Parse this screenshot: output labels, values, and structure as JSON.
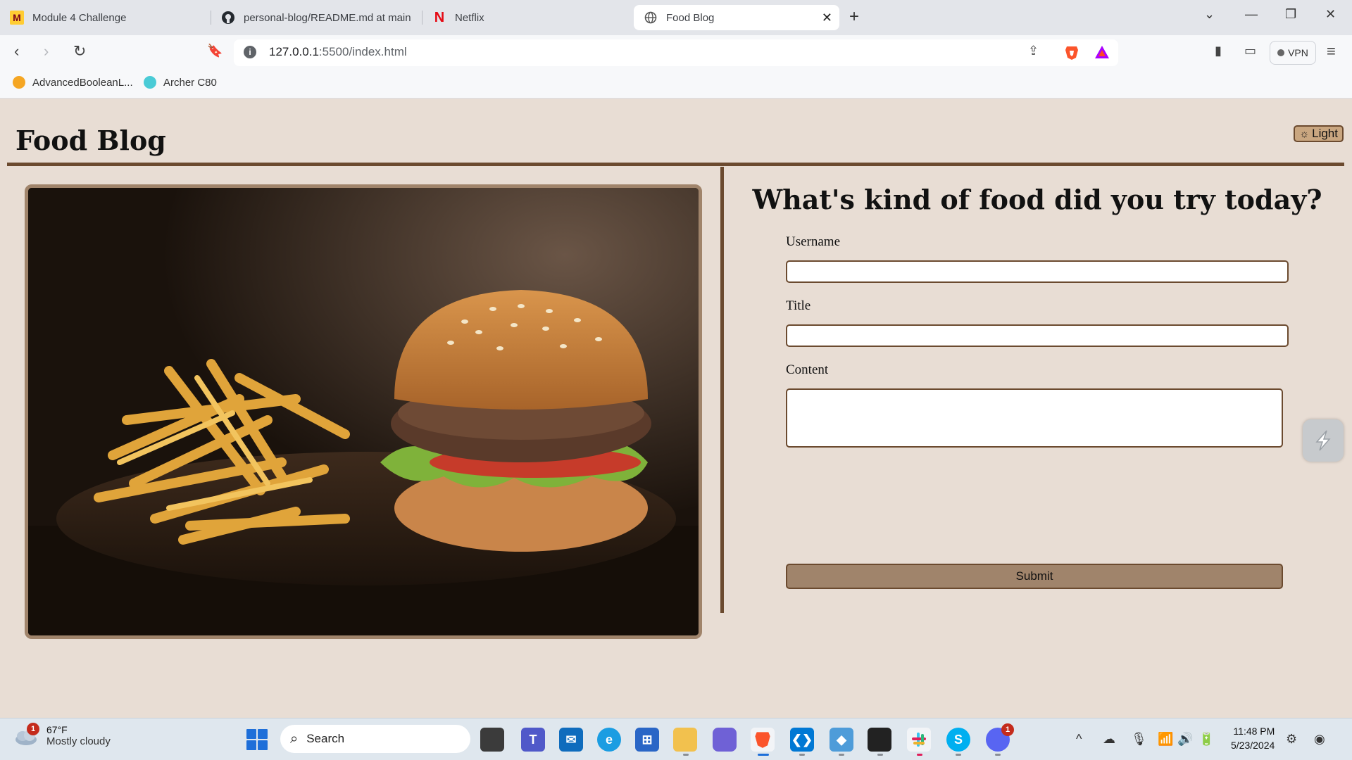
{
  "browser": {
    "tabs": [
      {
        "title": "Module 4 Challenge",
        "icon": "umn-logo-icon"
      },
      {
        "title": "personal-blog/README.md at main",
        "icon": "github-icon"
      },
      {
        "title": "Netflix",
        "icon": "netflix-icon"
      },
      {
        "title": "Food Blog",
        "icon": "globe-icon",
        "active": true
      }
    ],
    "url_host": "127.0.0.1",
    "url_path": ":5500/index.html",
    "vpn_label": "VPN",
    "bookmarks": [
      {
        "label": "AdvancedBooleanL...",
        "icon": "bookmark-orange-icon"
      },
      {
        "label": "Archer C80",
        "icon": "tplink-icon"
      }
    ]
  },
  "site": {
    "title": "Food Blog",
    "theme_toggle": "Light",
    "hero_image": "burger-and-fries-photo"
  },
  "form": {
    "heading": "What's kind of food did you try today?",
    "username_label": "Username",
    "username_value": "",
    "title_label": "Title",
    "title_value": "",
    "content_label": "Content",
    "content_value": "",
    "submit_label": "Submit"
  },
  "taskbar": {
    "weather_temp": "67°F",
    "weather_desc": "Mostly cloudy",
    "weather_badge": "1",
    "search_placeholder": "Search",
    "discord_badge": "1",
    "time": "11:48 PM",
    "date": "5/23/2024"
  },
  "colors": {
    "page_bg": "#e8ddd4",
    "accent_brown": "#6b4a2f",
    "button_tan": "#a0846b"
  }
}
